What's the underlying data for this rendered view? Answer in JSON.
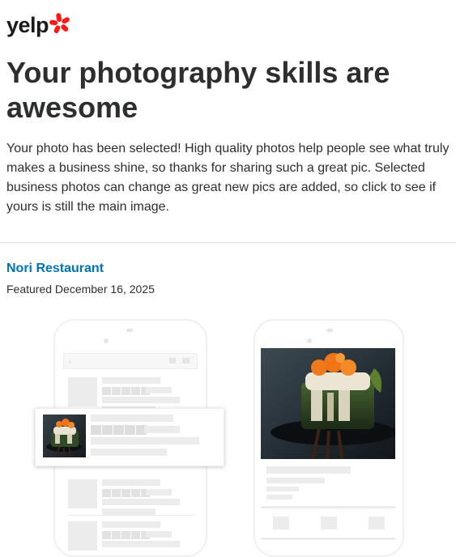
{
  "brand": {
    "logo_text": "yelp",
    "burst_color": "#ff1a1a",
    "icon": "yelp-burst-icon"
  },
  "email": {
    "headline": "Your photography skills are awesome",
    "body": "Your photo has been selected! High quality photos help people see what truly makes a business shine, so thanks for sharing such a great pic. Selected business photos can change as great new pics are added, so click to see if yours is still the main image."
  },
  "business": {
    "name": "Nori Restaurant",
    "featured_text": "Featured December 16, 2025"
  },
  "colors": {
    "link": "#0073bb",
    "text": "#2d2e2f"
  },
  "illustration": {
    "photo_subject": "sushi-roll-photo",
    "left_phone": "search-results-mockup",
    "right_phone": "business-page-mockup"
  }
}
